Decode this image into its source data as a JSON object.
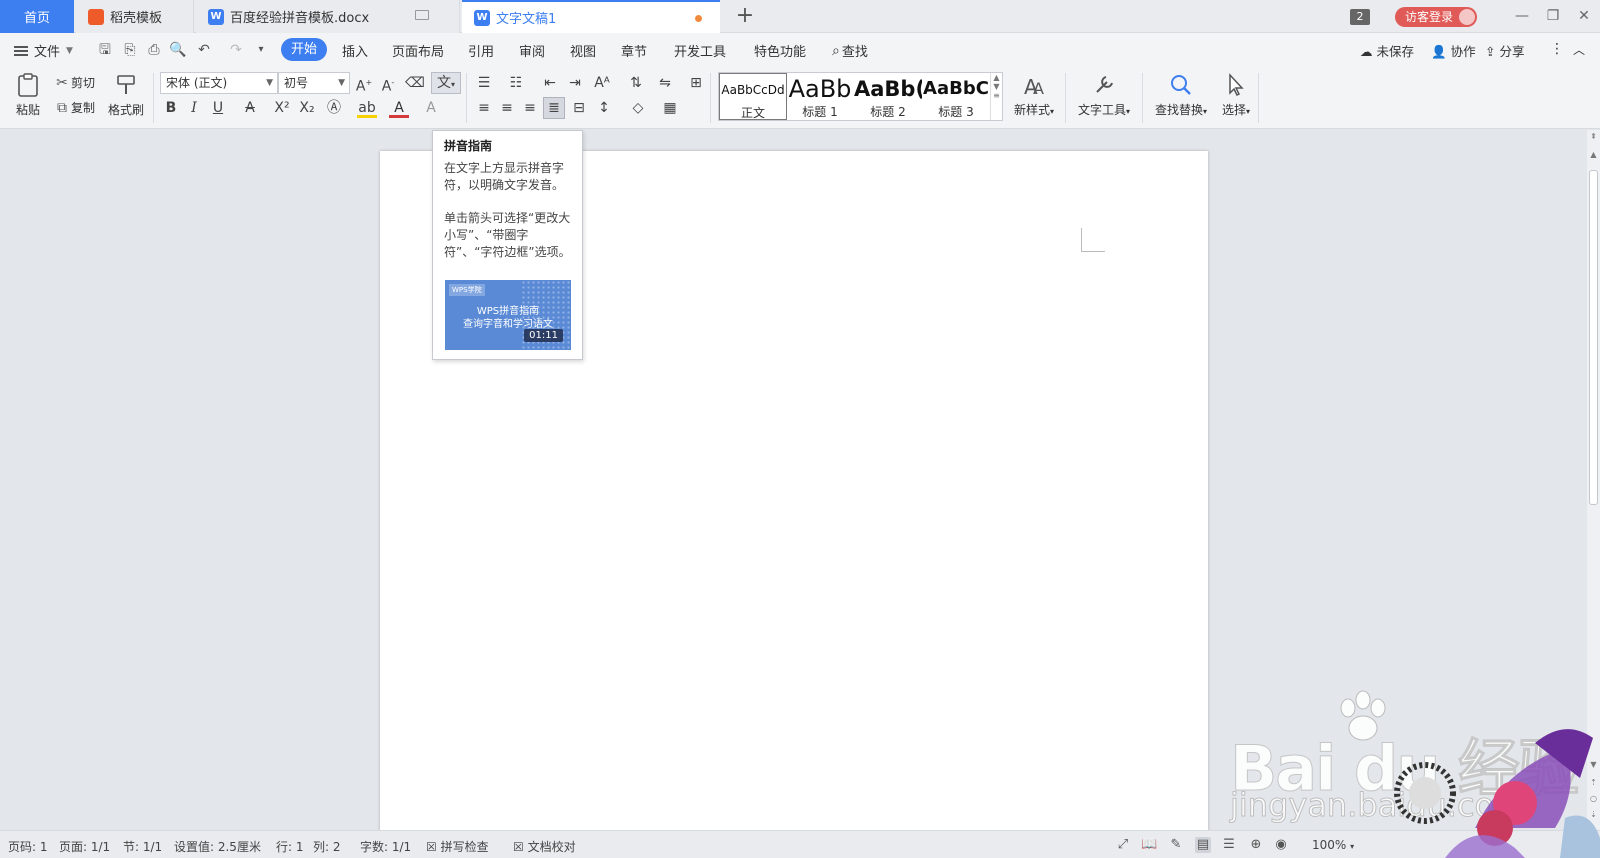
{
  "tabs": {
    "home": "首页",
    "daoke": "稻壳模板",
    "doc1": "百度经验拼音模板.docx",
    "doc2": "文字文稿1",
    "new_tab": "+",
    "window_count": "2",
    "visitor_login": "访客登录"
  },
  "menu": {
    "file": "文件",
    "start": "开始",
    "items": [
      "插入",
      "页面布局",
      "引用",
      "审阅",
      "视图",
      "章节",
      "开发工具",
      "特色功能"
    ],
    "search": "查找",
    "unsaved": "未保存",
    "collab": "协作",
    "share": "分享"
  },
  "ribbon": {
    "paste": "粘贴",
    "cut": "剪切",
    "copy": "复制",
    "format_painter": "格式刷",
    "font_name": "宋体 (正文)",
    "font_size": "初号",
    "styles": [
      {
        "preview": "AaBbCcDd",
        "name": "正文"
      },
      {
        "preview": "AaBb",
        "name": "标题 1"
      },
      {
        "preview": "AaBb(",
        "name": "标题 2"
      },
      {
        "preview": "AaBbC",
        "name": "标题 3"
      }
    ],
    "new_style": "新样式",
    "text_tools": "文字工具",
    "find_replace": "查找替换",
    "select": "选择"
  },
  "tooltip": {
    "title": "拼音指南",
    "desc1": "在文字上方显示拼音字符，以明确文字发音。",
    "desc2": "单击箭头可选择“更改大小写”、“带圈字符”、“字符边框”选项。",
    "video_logo": "WPS学院",
    "video_title1": "WPS拼音指南",
    "video_title2": "查询字音和学习语文",
    "video_duration": "01:11"
  },
  "status": {
    "page_num": "页码: 1",
    "pages": "页面: 1/1",
    "section": "节: 1/1",
    "setting": "设置值: 2.5厘米",
    "row": "行: 1",
    "col": "列: 2",
    "word_count": "字数: 1/1",
    "spell_check": "拼写检查",
    "doc_check": "文档校对",
    "zoom": "100%"
  },
  "watermark": {
    "brand": "Bai du 经验",
    "url": "jingyan.baidu.com"
  },
  "colors": {
    "accent": "#3d7ef0",
    "visitor": "#e05a57",
    "unsaved_dot": "#f08a3c"
  }
}
